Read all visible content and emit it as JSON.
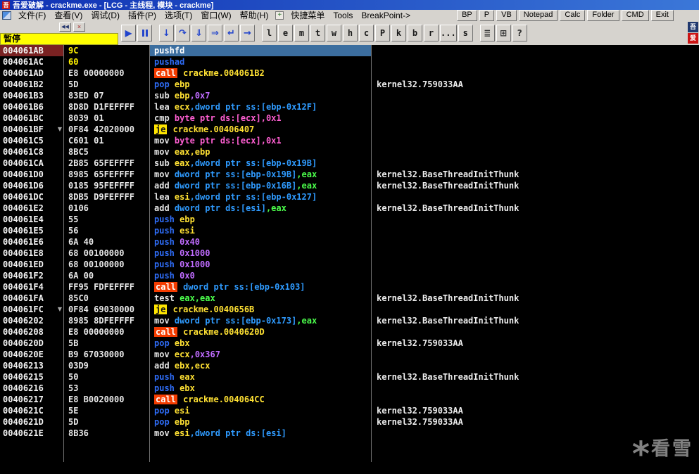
{
  "colors": {
    "title_bar_from": "#0F31B4",
    "title_bar_to": "#3B77D8",
    "menu_bg": "#D6D3CE",
    "pause_bg": "#FFFF00",
    "call_bg": "#F43C00",
    "je_bg": "#FFE400",
    "select_bg": "#3C6E9F",
    "eip_addr_bg": "#7A2222",
    "addr": "#F2F2F2",
    "bytes": "#E8E8E8",
    "bytes_modified": "#FFF200",
    "mn": "#E2E2E2",
    "pm": "#2E6CF6",
    "mem": "#2F9BFF",
    "reg": "#FFE133",
    "sym": "#FFE133",
    "num": "#C06CFF",
    "pink": "#FF5FD2",
    "grn": "#4CFF4C",
    "comment": "#EDEDED",
    "grid": "#6E6E6E",
    "watermark": "#8F8F8F",
    "toolbar_icon": "#2244CC"
  },
  "title_bar": {
    "app_icon": "吾",
    "title": "吾爱破解 - crackme.exe - [LCG - 主线程, 模块 - crackme]"
  },
  "menu_bar": {
    "items": [
      {
        "name": "file",
        "label": "文件(F)"
      },
      {
        "name": "view",
        "label": "查看(V)"
      },
      {
        "name": "debug",
        "label": "调试(D)"
      },
      {
        "name": "plugins",
        "label": "插件(P)"
      },
      {
        "name": "options",
        "label": "选项(T)"
      },
      {
        "name": "window",
        "label": "窗口(W)"
      },
      {
        "name": "help",
        "label": "帮助(H)"
      }
    ],
    "plus_icon": "+",
    "extra_items": [
      {
        "name": "shortcut-menu",
        "label": "快捷菜单"
      },
      {
        "name": "tools",
        "label": "Tools"
      },
      {
        "name": "breakpoint",
        "label": "BreakPoint->"
      }
    ],
    "action_buttons": [
      {
        "name": "bp",
        "label": "BP"
      },
      {
        "name": "p",
        "label": "P"
      },
      {
        "name": "vb",
        "label": "VB"
      },
      {
        "name": "notepad",
        "label": "Notepad"
      },
      {
        "name": "calc",
        "label": "Calc"
      },
      {
        "name": "folder",
        "label": "Folder"
      },
      {
        "name": "cmd",
        "label": "CMD"
      },
      {
        "name": "exit",
        "label": "Exit"
      }
    ]
  },
  "toolbar": {
    "status_label": "暂停",
    "mini_buttons": [
      {
        "name": "restart",
        "glyph": "◀◀"
      },
      {
        "name": "close",
        "glyph": "×"
      }
    ],
    "play_glyph": "▶",
    "step_buttons": [
      {
        "name": "step-into",
        "glyph": "↓"
      },
      {
        "name": "step-over",
        "glyph": "↷"
      },
      {
        "name": "animate-into",
        "glyph": "⇓"
      },
      {
        "name": "animate-over",
        "glyph": "⇒"
      },
      {
        "name": "until-return",
        "glyph": "↵"
      },
      {
        "name": "goto",
        "glyph": "→"
      }
    ],
    "letter_buttons": [
      {
        "name": "log",
        "label": "l"
      },
      {
        "name": "executable-modules",
        "label": "e"
      },
      {
        "name": "memory-map",
        "label": "m"
      },
      {
        "name": "threads",
        "label": "t"
      },
      {
        "name": "windows",
        "label": "w"
      },
      {
        "name": "handles",
        "label": "h"
      },
      {
        "name": "cpu",
        "label": "c"
      },
      {
        "name": "patches",
        "label": "P"
      },
      {
        "name": "call-stack",
        "label": "k"
      },
      {
        "name": "breakpoints",
        "label": "b"
      },
      {
        "name": "references",
        "label": "r"
      },
      {
        "name": "run-trace",
        "label": "..."
      },
      {
        "name": "source",
        "label": "s"
      }
    ],
    "panel_buttons": [
      {
        "name": "options-panel",
        "glyph": "≣"
      },
      {
        "name": "windows-panel",
        "glyph": "⊞"
      },
      {
        "name": "help-panel",
        "glyph": "?"
      }
    ],
    "corner_icons": [
      {
        "name": "logo-top",
        "glyph": "吾",
        "bg": "#20386E"
      },
      {
        "name": "logo-bottom",
        "glyph": "爱",
        "bg": "#CC1414"
      }
    ]
  },
  "disasm": {
    "rows": [
      {
        "addr": "004061AB",
        "bytes": "9C",
        "mod": true,
        "eip": true,
        "sel": true,
        "ins": [
          [
            "pushfd",
            "selw"
          ]
        ],
        "cmt": ""
      },
      {
        "addr": "004061AC",
        "bytes": "60",
        "mod": true,
        "ins": [
          [
            "pushad",
            "pm"
          ]
        ],
        "cmt": ""
      },
      {
        "addr": "004061AD",
        "bytes": "E8 00000000",
        "ins": [
          [
            "call",
            "callbg"
          ],
          [
            " crackme.004061B2",
            "sym"
          ]
        ],
        "cmt": ""
      },
      {
        "addr": "004061B2",
        "bytes": "5D",
        "ins": [
          [
            "pop ",
            "pm"
          ],
          [
            "ebp",
            "reg"
          ]
        ],
        "cmt": "kernel32.759033AA"
      },
      {
        "addr": "004061B3",
        "bytes": "83ED 07",
        "ins": [
          [
            "sub ",
            "mn"
          ],
          [
            "ebp",
            "reg"
          ],
          [
            ",0x7",
            "num"
          ]
        ],
        "cmt": ""
      },
      {
        "addr": "004061B6",
        "bytes": "8D8D D1FEFFFF",
        "ins": [
          [
            "lea ",
            "mn"
          ],
          [
            "ecx",
            "reg"
          ],
          [
            ",dword ptr ss:[ebp-0x12F]",
            "mem"
          ]
        ],
        "cmt": ""
      },
      {
        "addr": "004061BC",
        "bytes": "8039 01",
        "ins": [
          [
            "cmp ",
            "mn"
          ],
          [
            "byte ptr ds:[ecx],0x1",
            "pink"
          ]
        ],
        "cmt": ""
      },
      {
        "addr": "004061BF",
        "bytes": "0F84 42020000",
        "jm": true,
        "ins": [
          [
            "je",
            "jebg"
          ],
          [
            " crackme.00406407",
            "sym"
          ]
        ],
        "cmt": ""
      },
      {
        "addr": "004061C5",
        "bytes": "C601 01",
        "ins": [
          [
            "mov ",
            "mn"
          ],
          [
            "byte ptr ds:[ecx],0x1",
            "pink"
          ]
        ],
        "cmt": ""
      },
      {
        "addr": "004061C8",
        "bytes": "8BC5",
        "ins": [
          [
            "mov ",
            "mn"
          ],
          [
            "eax,ebp",
            "reg"
          ]
        ],
        "cmt": ""
      },
      {
        "addr": "004061CA",
        "bytes": "2B85 65FEFFFF",
        "ins": [
          [
            "sub ",
            "mn"
          ],
          [
            "eax",
            "reg"
          ],
          [
            ",dword ptr ss:[ebp-0x19B]",
            "mem"
          ]
        ],
        "cmt": ""
      },
      {
        "addr": "004061D0",
        "bytes": "8985 65FEFFFF",
        "ins": [
          [
            "mov ",
            "mn"
          ],
          [
            "dword ptr ss:[ebp-0x19B]",
            "mem"
          ],
          [
            ",eax",
            "grn"
          ]
        ],
        "cmt": "kernel32.BaseThreadInitThunk"
      },
      {
        "addr": "004061D6",
        "bytes": "0185 95FEFFFF",
        "ins": [
          [
            "add ",
            "mn"
          ],
          [
            "dword ptr ss:[ebp-0x16B]",
            "mem"
          ],
          [
            ",eax",
            "grn"
          ]
        ],
        "cmt": "kernel32.BaseThreadInitThunk"
      },
      {
        "addr": "004061DC",
        "bytes": "8DB5 D9FEFFFF",
        "ins": [
          [
            "lea ",
            "mn"
          ],
          [
            "esi",
            "reg"
          ],
          [
            ",dword ptr ss:[ebp-0x127]",
            "mem"
          ]
        ],
        "cmt": ""
      },
      {
        "addr": "004061E2",
        "bytes": "0106",
        "ins": [
          [
            "add ",
            "mn"
          ],
          [
            "dword ptr ds:[esi]",
            "mem"
          ],
          [
            ",eax",
            "grn"
          ]
        ],
        "cmt": "kernel32.BaseThreadInitThunk"
      },
      {
        "addr": "004061E4",
        "bytes": "55",
        "ins": [
          [
            "push ",
            "pm"
          ],
          [
            "ebp",
            "reg"
          ]
        ],
        "cmt": ""
      },
      {
        "addr": "004061E5",
        "bytes": "56",
        "ins": [
          [
            "push ",
            "pm"
          ],
          [
            "esi",
            "reg"
          ]
        ],
        "cmt": ""
      },
      {
        "addr": "004061E6",
        "bytes": "6A 40",
        "ins": [
          [
            "push ",
            "pm"
          ],
          [
            "0x40",
            "num"
          ]
        ],
        "cmt": ""
      },
      {
        "addr": "004061E8",
        "bytes": "68 00100000",
        "ins": [
          [
            "push ",
            "pm"
          ],
          [
            "0x1000",
            "num"
          ]
        ],
        "cmt": ""
      },
      {
        "addr": "004061ED",
        "bytes": "68 00100000",
        "ins": [
          [
            "push ",
            "pm"
          ],
          [
            "0x1000",
            "num"
          ]
        ],
        "cmt": ""
      },
      {
        "addr": "004061F2",
        "bytes": "6A 00",
        "ins": [
          [
            "push ",
            "pm"
          ],
          [
            "0x0",
            "num"
          ]
        ],
        "cmt": ""
      },
      {
        "addr": "004061F4",
        "bytes": "FF95 FDFEFFFF",
        "ins": [
          [
            "call",
            "callbg"
          ],
          [
            " dword ptr ss:[ebp-0x103]",
            "mem"
          ]
        ],
        "cmt": ""
      },
      {
        "addr": "004061FA",
        "bytes": "85C0",
        "ins": [
          [
            "test ",
            "mn"
          ],
          [
            "eax,eax",
            "grn"
          ]
        ],
        "cmt": "kernel32.BaseThreadInitThunk"
      },
      {
        "addr": "004061FC",
        "bytes": "0F84 69030000",
        "jm": true,
        "ins": [
          [
            "je",
            "jebg"
          ],
          [
            " crackme.0040656B",
            "sym"
          ]
        ],
        "cmt": ""
      },
      {
        "addr": "00406202",
        "bytes": "8985 8DFEFFFF",
        "ins": [
          [
            "mov ",
            "mn"
          ],
          [
            "dword ptr ss:[ebp-0x173]",
            "mem"
          ],
          [
            ",eax",
            "grn"
          ]
        ],
        "cmt": "kernel32.BaseThreadInitThunk"
      },
      {
        "addr": "00406208",
        "bytes": "E8 00000000",
        "ins": [
          [
            "call",
            "callbg"
          ],
          [
            " crackme.0040620D",
            "sym"
          ]
        ],
        "cmt": ""
      },
      {
        "addr": "0040620D",
        "bytes": "5B",
        "ins": [
          [
            "pop ",
            "pm"
          ],
          [
            "ebx",
            "reg"
          ]
        ],
        "cmt": "kernel32.759033AA"
      },
      {
        "addr": "0040620E",
        "bytes": "B9 67030000",
        "ins": [
          [
            "mov ",
            "mn"
          ],
          [
            "ecx",
            "reg"
          ],
          [
            ",0x367",
            "num"
          ]
        ],
        "cmt": ""
      },
      {
        "addr": "00406213",
        "bytes": "03D9",
        "ins": [
          [
            "add ",
            "mn"
          ],
          [
            "ebx,ecx",
            "reg"
          ]
        ],
        "cmt": ""
      },
      {
        "addr": "00406215",
        "bytes": "50",
        "ins": [
          [
            "push ",
            "pm"
          ],
          [
            "eax",
            "reg"
          ]
        ],
        "cmt": "kernel32.BaseThreadInitThunk"
      },
      {
        "addr": "00406216",
        "bytes": "53",
        "ins": [
          [
            "push ",
            "pm"
          ],
          [
            "ebx",
            "reg"
          ]
        ],
        "cmt": ""
      },
      {
        "addr": "00406217",
        "bytes": "E8 B0020000",
        "ins": [
          [
            "call",
            "callbg"
          ],
          [
            " crackme.004064CC",
            "sym"
          ]
        ],
        "cmt": ""
      },
      {
        "addr": "0040621C",
        "bytes": "5E",
        "ins": [
          [
            "pop ",
            "pm"
          ],
          [
            "esi",
            "reg"
          ]
        ],
        "cmt": "kernel32.759033AA"
      },
      {
        "addr": "0040621D",
        "bytes": "5D",
        "ins": [
          [
            "pop ",
            "pm"
          ],
          [
            "ebp",
            "reg"
          ]
        ],
        "cmt": "kernel32.759033AA"
      },
      {
        "addr": "0040621E",
        "bytes": "8B36",
        "ins": [
          [
            "mov ",
            "mn"
          ],
          [
            "esi",
            "reg"
          ],
          [
            ",dword ptr ds:[esi]",
            "mem"
          ]
        ],
        "cmt": ""
      }
    ]
  },
  "watermark": {
    "icon": "*",
    "text": "看雪"
  }
}
